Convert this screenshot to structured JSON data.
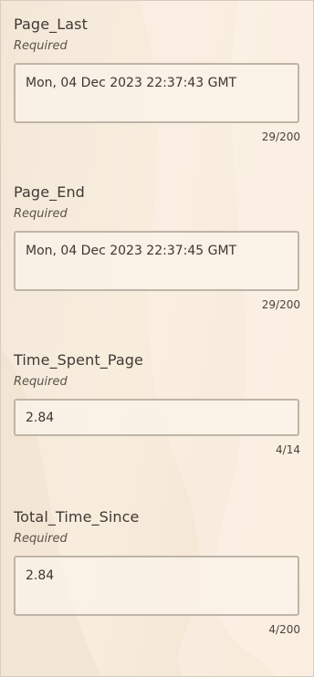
{
  "fields": [
    {
      "label": "Page_Last",
      "required": "Required",
      "value": "Mon, 04 Dec 2023 22:37:43 GMT",
      "counter": "29/200"
    },
    {
      "label": "Page_End",
      "required": "Required",
      "value": "Mon, 04 Dec 2023 22:37:45 GMT",
      "counter": "29/200"
    },
    {
      "label": "Time_Spent_Page",
      "required": "Required",
      "value": "2.84",
      "counter": "4/14"
    },
    {
      "label": "Total_Time_Since",
      "required": "Required",
      "value": "2.84",
      "counter": "4/200"
    }
  ],
  "colors": {
    "background": "#f6eadb",
    "field_border": "#bfb5a6",
    "field_fill": "#fbf3e9"
  }
}
